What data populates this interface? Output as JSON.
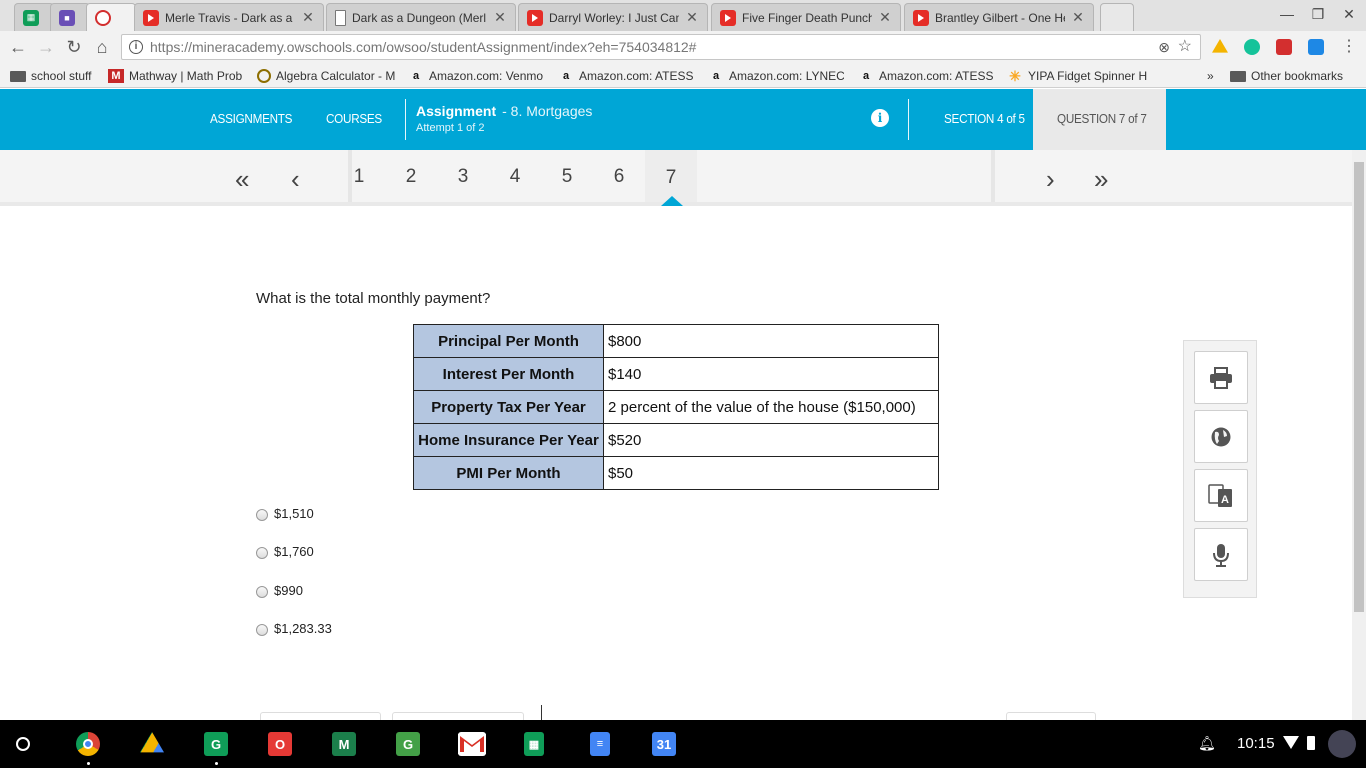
{
  "browser": {
    "tabs": [
      {
        "title": "",
        "icon": "sheets-icon"
      },
      {
        "title": "",
        "icon": "classroom-icon"
      },
      {
        "title": "",
        "icon": "owschools-icon",
        "active": true
      },
      {
        "title": "Merle Travis - Dark as a D",
        "icon": "youtube-icon"
      },
      {
        "title": "Dark as a Dungeon (Merl",
        "icon": "document-icon"
      },
      {
        "title": "Darryl Worley: I Just Can",
        "icon": "youtube-icon"
      },
      {
        "title": "Five Finger Death Punch",
        "icon": "youtube-icon"
      },
      {
        "title": "Brantley Gilbert - One He",
        "icon": "youtube-icon"
      }
    ],
    "url_host": "https://mineracademy.owschools.com",
    "url_path": "/owsoo/studentAssignment/index?eh=754034812#",
    "bookmarks": [
      {
        "label": "school stuff",
        "icon": "folder-icon"
      },
      {
        "label": "Mathway | Math Prob",
        "icon": "mathway-icon"
      },
      {
        "label": "Algebra Calculator - M",
        "icon": "calculator-icon"
      },
      {
        "label": "Amazon.com: Venmo",
        "icon": "amazon-icon"
      },
      {
        "label": "Amazon.com: ATESS",
        "icon": "amazon-icon"
      },
      {
        "label": "Amazon.com: LYNEC",
        "icon": "amazon-icon"
      },
      {
        "label": "Amazon.com: ATESS",
        "icon": "amazon-icon"
      },
      {
        "label": "YIPA Fidget Spinner H",
        "icon": "walmart-icon"
      }
    ],
    "bookmarks_overflow": "»",
    "other_bookmarks": "Other bookmarks"
  },
  "header": {
    "nav_assignments": "ASSIGNMENTS",
    "nav_courses": "COURSES",
    "assignment_label": "Assignment",
    "assignment_name": "- 8. Mortgages",
    "attempt": "Attempt 1 of 2",
    "section": "SECTION 4 of 5",
    "question": "QUESTION 7 of 7"
  },
  "qnav": {
    "numbers": [
      "1",
      "2",
      "3",
      "4",
      "5",
      "6",
      "7"
    ],
    "current": "7"
  },
  "question": {
    "prompt": "What is the total monthly payment?",
    "table": [
      {
        "label": "Principal Per Month",
        "value": "$800"
      },
      {
        "label": "Interest Per Month",
        "value": "$140"
      },
      {
        "label": "Property Tax Per Year",
        "value": "2 percent of the value of the house ($150,000)"
      },
      {
        "label": "Home Insurance Per Year",
        "value": "$520"
      },
      {
        "label": "PMI Per Month",
        "value": "$50"
      }
    ],
    "choices": [
      "$1,510",
      "$1,760",
      "$990",
      "$1,283.33"
    ]
  },
  "tools": [
    "printer-icon",
    "globe-icon",
    "translate-icon",
    "microphone-icon"
  ],
  "taskbar": {
    "apps": [
      {
        "icon": "chrome-icon",
        "label": ""
      },
      {
        "icon": "drive-icon",
        "label": ""
      },
      {
        "icon": "classroom-green-icon",
        "label": "G"
      },
      {
        "icon": "office-icon",
        "label": "O"
      },
      {
        "icon": "app-m-icon",
        "label": "M"
      },
      {
        "icon": "app-g-icon",
        "label": "G"
      },
      {
        "icon": "gmail-icon",
        "label": ""
      },
      {
        "icon": "sheets-icon",
        "label": ""
      },
      {
        "icon": "docs-icon",
        "label": ""
      },
      {
        "icon": "calendar-icon",
        "label": "31"
      }
    ],
    "time": "10:15"
  },
  "colors": {
    "header_bg": "#00a6d6",
    "table_header_bg": "#b4c6e0"
  }
}
